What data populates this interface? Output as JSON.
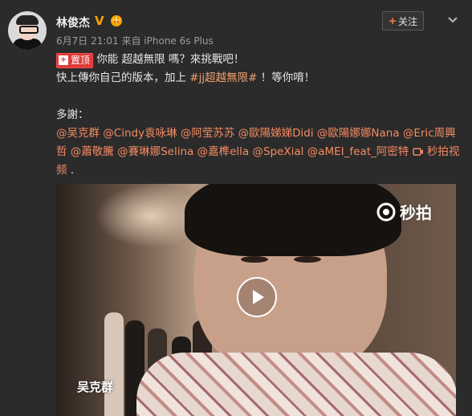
{
  "author": {
    "name": "林俊杰",
    "verified_badge": "V",
    "follow_label": "关注",
    "follow_plus": "+"
  },
  "post": {
    "meta": "6月7日 21:01 来自 iPhone 6s Plus",
    "hot_label": "置顶",
    "line1_text": "你能 超越無限 嗎？來挑戰吧！",
    "line2_pre": "快上傳你自己的版本，加上 ",
    "line2_tag": "#jj超越無限#",
    "line2_post": " ！等你唷！",
    "thanks": "多謝：",
    "mentions_text": "@吴克群 @Cindy袁咏琳 @阿莹苏苏 @歐陽娣娣Didi @歐陽娜娜Nana @Eric周興哲 @蕭敬騰 @賽琳娜Selina @嘉榫ella @SpeXial @aMEI_feat_阿密特",
    "video_link": "秒拍视频",
    "trailing": " ."
  },
  "video": {
    "watermark": "秒拍",
    "caption": "吴克群"
  },
  "colors": {
    "background": "#2b2b2b",
    "link": "#f58a61",
    "hot": "#e03a3a"
  }
}
